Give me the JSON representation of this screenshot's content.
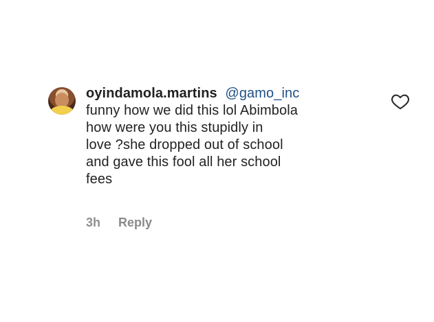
{
  "comment": {
    "username": "oyindamola.martins",
    "mention": "@gamo_inc",
    "text": "funny how we did this lol Abimbola\nhow were you this stupidly in\nlove ?she dropped out of school\nand gave this fool all her school\nfees",
    "time": "3h",
    "reply_label": "Reply",
    "like_icon": "heart-icon"
  }
}
